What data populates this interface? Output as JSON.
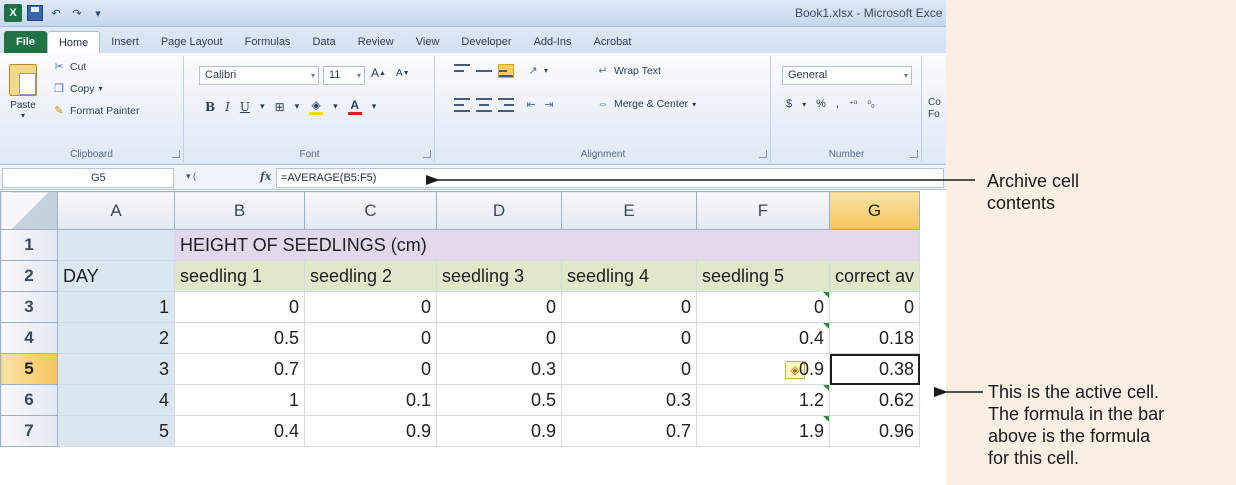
{
  "window": {
    "title": "Book1.xlsx - Microsoft Exce"
  },
  "tabs": [
    "File",
    "Home",
    "Insert",
    "Page Layout",
    "Formulas",
    "Data",
    "Review",
    "View",
    "Developer",
    "Add-Ins",
    "Acrobat"
  ],
  "active_tab": "Home",
  "ribbon": {
    "clipboard": {
      "label": "Clipboard",
      "paste": "Paste",
      "cut": "Cut",
      "copy": "Copy",
      "format_painter": "Format Painter"
    },
    "font": {
      "label": "Font",
      "font_name": "Calibri",
      "font_size": "11"
    },
    "alignment": {
      "label": "Alignment",
      "wrap_text": "Wrap Text",
      "merge_center": "Merge & Center"
    },
    "number": {
      "label": "Number",
      "format": "General",
      "currency": "$",
      "percent": "%"
    },
    "styles_partial": "Co Fo"
  },
  "formula_bar": {
    "name_box": "G5",
    "fx": "fx",
    "formula": "=AVERAGE(B5:F5)"
  },
  "sheet": {
    "columns": [
      "A",
      "B",
      "C",
      "D",
      "E",
      "F",
      "G"
    ],
    "selected_column": "G",
    "selected_row": "5",
    "rows": [
      {
        "num": "1",
        "cells": [
          "",
          "HEIGHT OF SEEDLINGS (cm)",
          "",
          "",
          "",
          "",
          ""
        ]
      },
      {
        "num": "2",
        "cells": [
          "DAY",
          "seedling 1",
          "seedling 2",
          "seedling 3",
          "seedling 4",
          "seedling 5",
          "correct av"
        ]
      },
      {
        "num": "3",
        "cells": [
          "1",
          "0",
          "0",
          "0",
          "0",
          "0",
          "0"
        ]
      },
      {
        "num": "4",
        "cells": [
          "2",
          "0.5",
          "0",
          "0",
          "0",
          "0.4",
          "0.18"
        ]
      },
      {
        "num": "5",
        "cells": [
          "3",
          "0.7",
          "0",
          "0.3",
          "0",
          "0.9",
          "0.38"
        ]
      },
      {
        "num": "6",
        "cells": [
          "4",
          "1",
          "0.1",
          "0.5",
          "0.3",
          "1.2",
          "0.62"
        ]
      },
      {
        "num": "7",
        "cells": [
          "5",
          "0.4",
          "0.9",
          "0.9",
          "0.7",
          "1.9",
          "0.96"
        ]
      }
    ],
    "active_cell": "G5"
  },
  "annotations": {
    "formula_callout": "Archive cell contents",
    "formula_callout_lines": [
      "Archive cell",
      "contents"
    ],
    "active_callout_lines": [
      "This is the active cell.",
      "The formula in the bar",
      "above is the formula",
      "for this cell."
    ]
  },
  "colors": {
    "file_tab": "#217346",
    "title_row": "#e3d7ec",
    "header_row": "#dfe9c9",
    "day_column": "#dbe6f1",
    "selected_header": "#f6c65c",
    "annotation_bg": "#fbeee3"
  }
}
